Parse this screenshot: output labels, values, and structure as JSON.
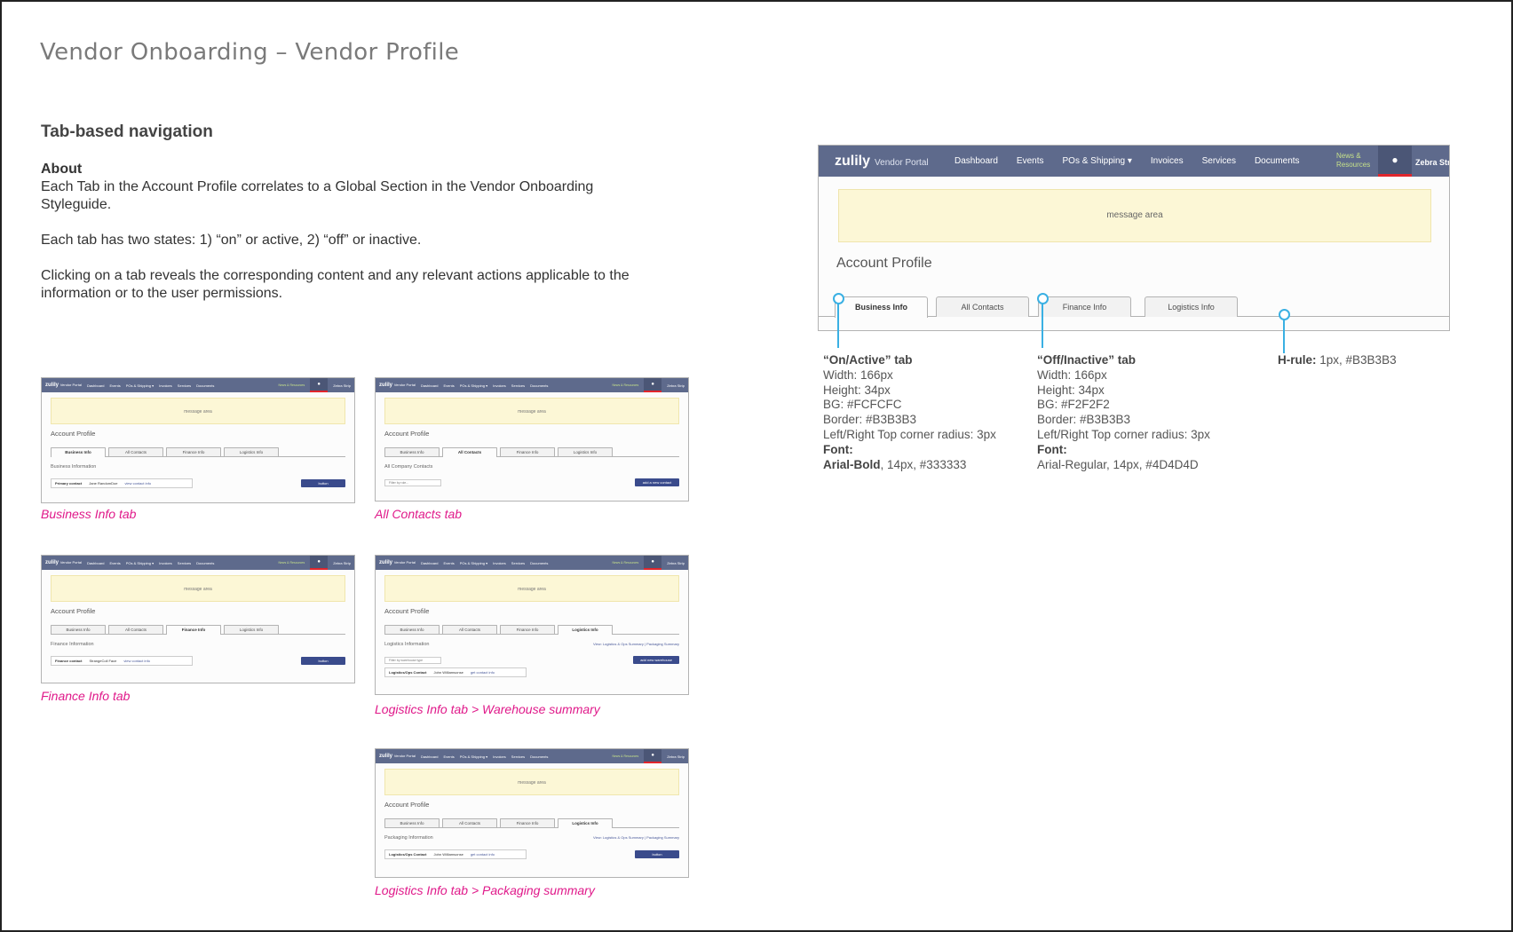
{
  "page": {
    "title": "Vendor Onboarding – Vendor Profile",
    "section_title": "Tab-based navigation",
    "about_heading": "About",
    "about_p1": "Each Tab in the Account Profile correlates to a Global Section in the Vendor Onboarding Styleguide.",
    "about_p2": "Each tab has two states: 1) “on” or active, 2) “off” or inactive.",
    "about_p3": "Clicking on a tab reveals the corresponding content and any relevant actions applicable to the information or to the user permissions."
  },
  "nav": {
    "logo": "zulily",
    "logo_sub": "Vendor Portal",
    "items": [
      "Dashboard",
      "Events",
      "POs & Shipping ▾",
      "Invoices",
      "Services",
      "Documents"
    ],
    "news": "News & Resources",
    "user_icon": "user-icon",
    "user_name": "Zebra Strip"
  },
  "message_area": "message area",
  "account_profile": "Account Profile",
  "tabs": [
    "Business Info",
    "All Contacts",
    "Finance Info",
    "Logistics Info"
  ],
  "thumbs": {
    "business": {
      "caption": "Business Info tab",
      "sub": "Business Information",
      "box_label": "Primary contact",
      "box_value": "Jane RandomDoe",
      "box_link": "view contact info",
      "button": "button"
    },
    "contacts": {
      "caption": "All Contacts tab",
      "sub": "All Company Contacts",
      "filter": "Filter by role...",
      "button": "add a new contact"
    },
    "finance": {
      "caption": "Finance Info tab",
      "sub": "Finance Information",
      "box_label": "Finance contact",
      "box_value": "StrangeColl Face",
      "box_link": "view contact info",
      "button": "button"
    },
    "warehouse": {
      "caption": "Logistics Info tab > Warehouse summary",
      "sub": "Logistics Information",
      "links": "View: Logistics & Ops Summary | Packaging Summary",
      "filter": "Filter by warehouse type",
      "button": "add new warehouse",
      "box_label": "Logistics/Ops Contact",
      "box_value": "John Williamsonse",
      "box_link": "get contact info"
    },
    "packaging": {
      "caption": "Logistics Info tab > Packaging summary",
      "sub": "Packaging Information",
      "links": "View: Logistics & Ops Summary | Packaging Summary",
      "box_label": "Logistics/Ops Contact",
      "box_value": "John Williamsonse",
      "box_link": "get contact info",
      "button": "button"
    }
  },
  "specs": {
    "on": {
      "title": "“On/Active” tab",
      "lines": [
        "Width: 166px",
        "Height: 34px",
        "BG: #FCFCFC",
        "Border: #B3B3B3",
        "Left/Right Top corner radius: 3px"
      ],
      "font_label": "Font:",
      "font_bold": "Arial-Bold",
      "font_rest": ", 14px, #333333"
    },
    "off": {
      "title": "“Off/Inactive” tab",
      "lines": [
        "Width: 166px",
        "Height: 34px",
        "BG: #F2F2F2",
        "Border: #B3B3B3",
        "Left/Right Top corner radius: 3px"
      ],
      "font_label": "Font:",
      "font_value": "Arial-Regular, 14px, #4D4D4D"
    },
    "hrule": {
      "label": "H-rule:",
      "value": "1px, #B3B3B3"
    }
  },
  "colors": {
    "nav_bg": "#5E6A8C",
    "message_bg": "#FCF7D6",
    "caption": "#E0198A",
    "annotation": "#3AB0E3",
    "button": "#3A4B8C"
  }
}
